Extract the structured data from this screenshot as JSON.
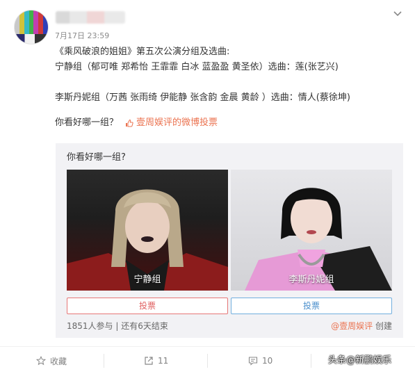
{
  "post": {
    "timestamp": "7月17日 23:59",
    "lines": [
      "《乘风破浪的姐姐》第五次公演分组及选曲:",
      "宁静组（郁可唯 郑希怡 王霏霏 白冰 蓝盈盈 黄圣依）选曲：莲(张艺兴)",
      "李斯丹妮组（万茜 张雨绮 伊能静 张含韵 金晨 黄龄 ）选曲：情人(蔡徐坤)"
    ],
    "question": "你看好哪一组？",
    "vote_link": "壹周娱评的微博投票"
  },
  "vote_card": {
    "question": "你看好哪一组?",
    "options": [
      {
        "label": "宁静组",
        "button": "投票"
      },
      {
        "label": "李斯丹妮组",
        "button": "投票"
      }
    ],
    "stats": "1851人参与 | 还有6天结束",
    "creator_name": "@壹周娱评",
    "creator_suffix": " 创建"
  },
  "actions": {
    "favorite": "收藏",
    "repost": "11",
    "comment": "10"
  },
  "watermark": "头条@新鹏娱乐",
  "colors": {
    "accent": "#eb7350",
    "vote_left": "#e06161",
    "vote_right": "#4b8fcc"
  }
}
